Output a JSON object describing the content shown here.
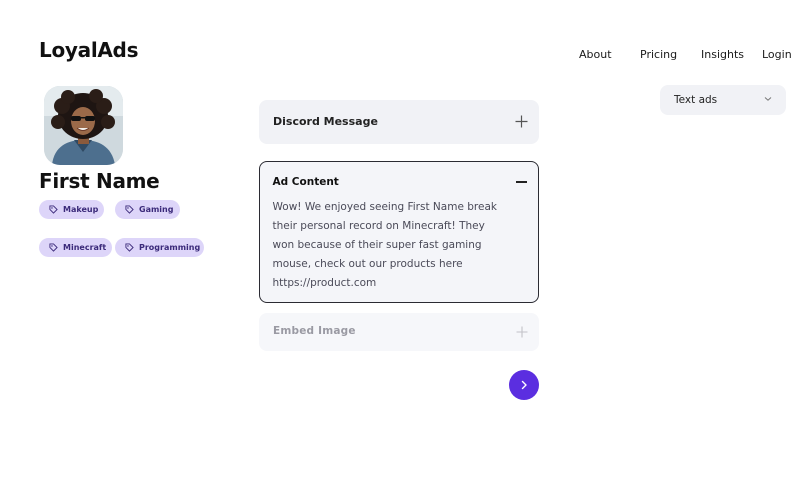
{
  "brand": {
    "logo": "LoyalAds"
  },
  "nav": {
    "items": [
      "About",
      "Pricing",
      "Insights",
      "Login"
    ]
  },
  "ad_type_select": {
    "value": "Text ads"
  },
  "profile": {
    "name": "First Name",
    "tags": [
      "Makeup",
      "Gaming",
      "Minecraft",
      "Programming"
    ]
  },
  "sections": {
    "discord_message": {
      "title": "Discord Message",
      "state": "collapsed"
    },
    "ad_content": {
      "title": "Ad Content",
      "state": "expanded",
      "body": "Wow! We enjoyed seeing First Name break their personal record on Minecraft! They won because of their super fast gaming mouse, check out our products here  https://product.com"
    },
    "embed_image": {
      "title": "Embed  Image",
      "state": "collapsed-disabled"
    }
  },
  "icons": {
    "tag": "tag-icon",
    "expand": "plus-icon",
    "collapse": "minus-icon",
    "next": "chevron-right-icon",
    "dropdown": "chevron-down-icon"
  },
  "colors": {
    "accent": "#5b2ee0",
    "tag_bg": "#ddd5f9",
    "tag_text": "#3b2a7a",
    "card_bg": "#f1f2f6"
  }
}
